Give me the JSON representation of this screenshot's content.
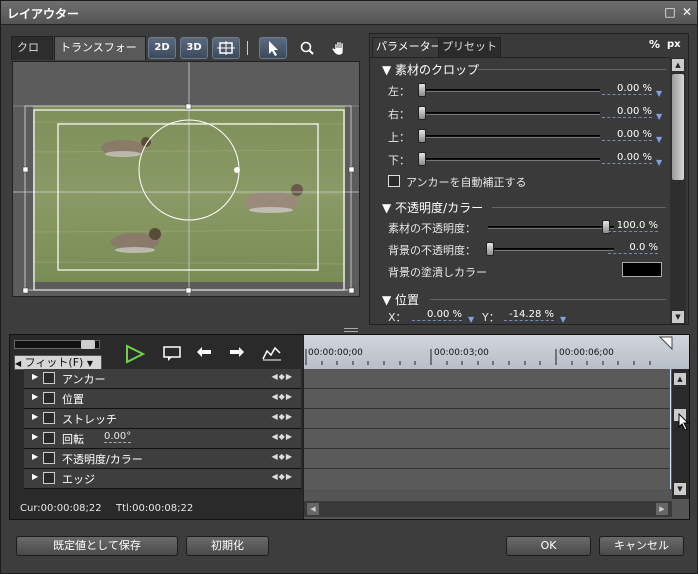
{
  "window": {
    "title": "レイアウター"
  },
  "left_tabs": [
    "クロップ",
    "トランスフォーム"
  ],
  "tools": {
    "t2d": "2D",
    "t3d": "3D"
  },
  "right_tabs": [
    "パラメーター",
    "プリセット"
  ],
  "units": {
    "percent": "%",
    "px": "px"
  },
  "crop": {
    "title": "素材のクロップ",
    "rows": [
      {
        "label": "左：",
        "value": "0.00 %"
      },
      {
        "label": "右：",
        "value": "0.00 %"
      },
      {
        "label": "上：",
        "value": "0.00 %"
      },
      {
        "label": "下：",
        "value": "0.00 %"
      }
    ],
    "anchor_checkbox": "アンカーを自動補正する"
  },
  "opacity": {
    "title": "不透明度/カラー",
    "source_label": "素材の不透明度：",
    "source_value": "100.0 %",
    "source_level": 1.0,
    "bg_label": "背景の不透明度：",
    "bg_value": "0.0 %",
    "bg_level": 0.0,
    "fill_label": "背景の塗潰しカラー",
    "fill_color": "#000000"
  },
  "position": {
    "title": "位置",
    "x_label": "X：",
    "x_value": "0.00 %",
    "y_label": "Y：",
    "y_value": "-14.28 %"
  },
  "timeline": {
    "fit_label": "フィット(F)",
    "ruler": [
      "00:00:00;00",
      "00:00:03;00",
      "00:00:06;00"
    ],
    "tracks": [
      {
        "name": "アンカー"
      },
      {
        "name": "位置"
      },
      {
        "name": "ストレッチ"
      },
      {
        "name": "回転",
        "value": "0.00°"
      },
      {
        "name": "不透明度/カラー"
      },
      {
        "name": "エッジ"
      }
    ],
    "cur": "Cur:00:00:08;22",
    "ttl": "Ttl:00:00:08;22"
  },
  "buttons": {
    "save_default": "既定値として保存",
    "init": "初期化",
    "ok": "OK",
    "cancel": "キャンセル"
  }
}
